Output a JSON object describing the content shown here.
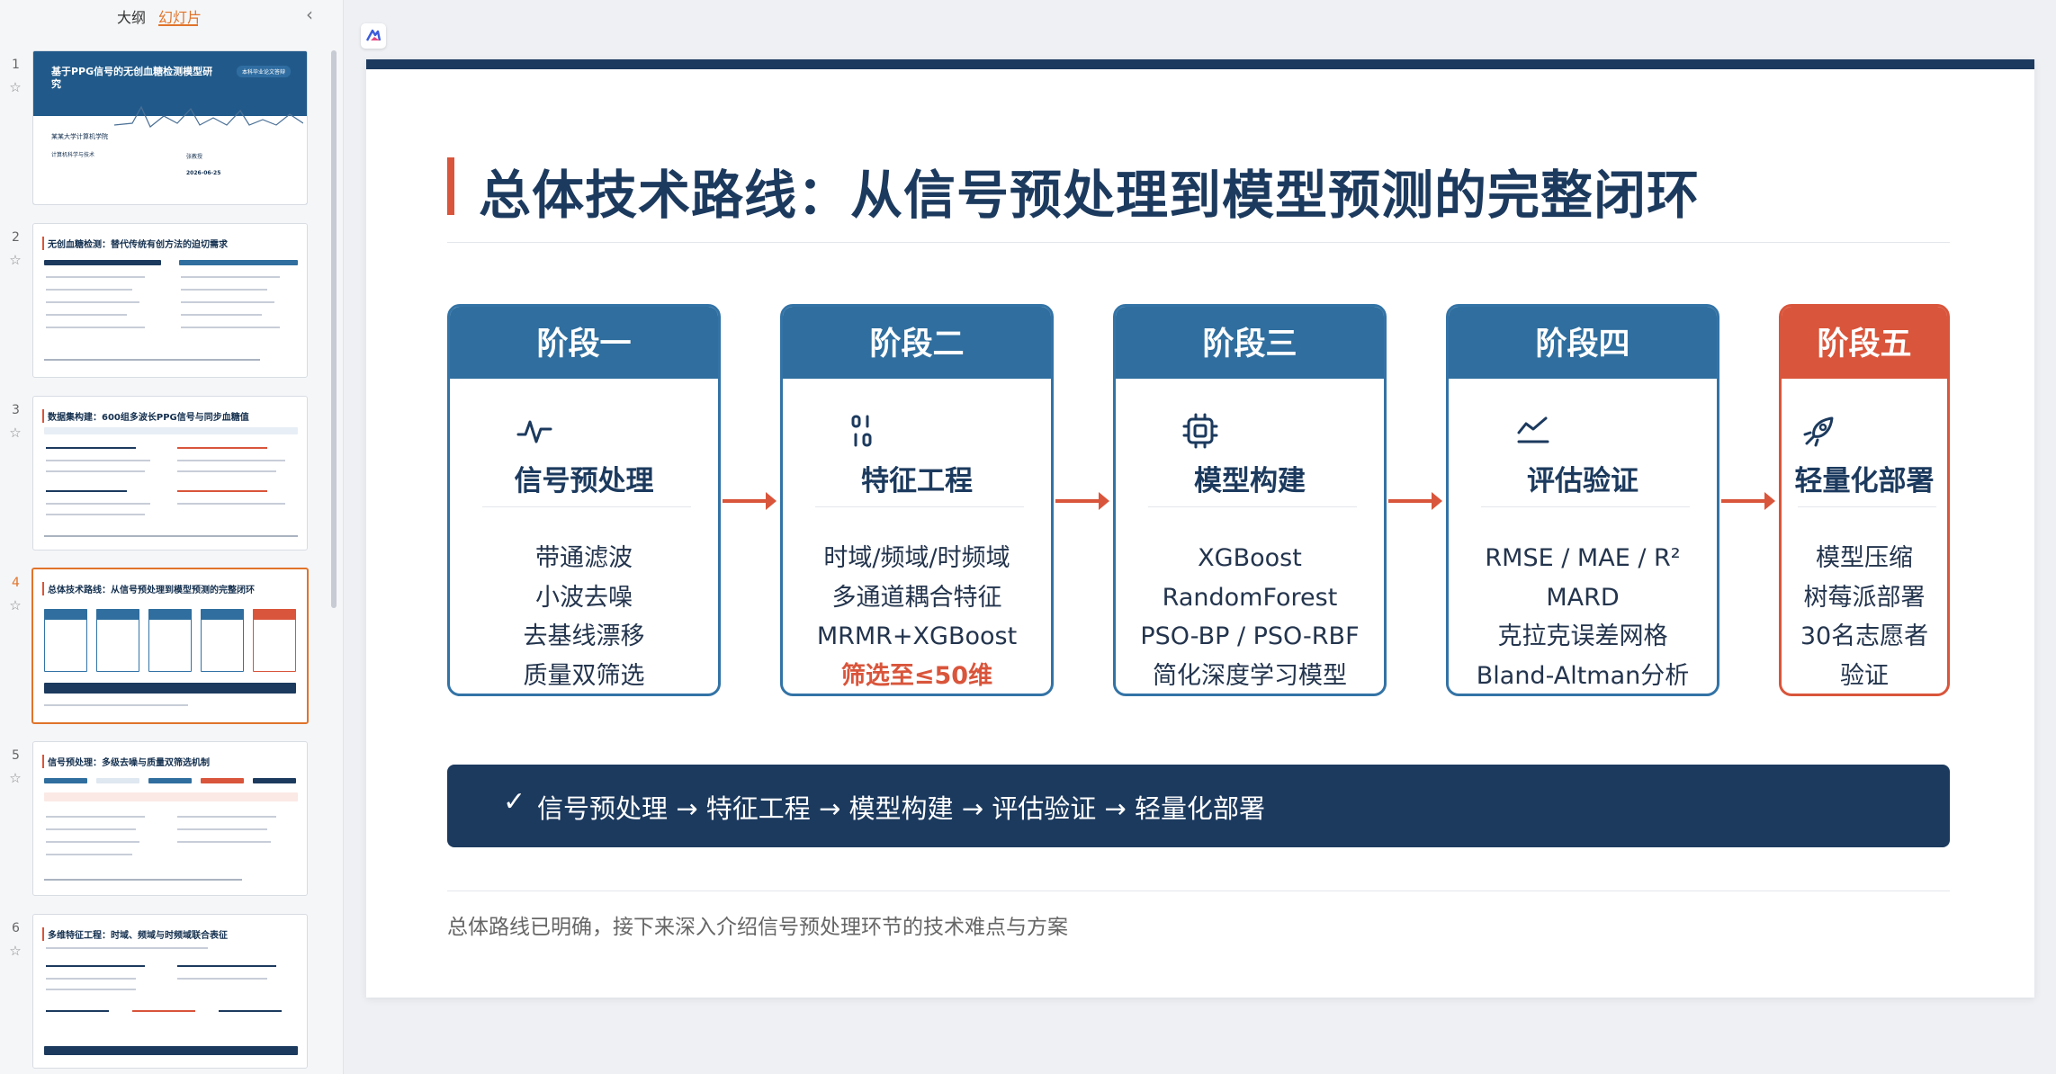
{
  "panel": {
    "tabs": [
      {
        "label": "大纲"
      },
      {
        "label": "幻灯片"
      }
    ],
    "collapse_icon": "chevron-left-icon",
    "thumbnails": [
      {
        "number": "1",
        "title": "基于PPG信号的无创血糖检测模型研究",
        "badge": "本科毕业论文答辩",
        "school": "某某大学计算机学院",
        "major": "计算机科学与技术",
        "advisor": "张教授",
        "date": "2026-06-25"
      },
      {
        "number": "2",
        "title": "无创血糖检测：替代传统有创方法的迫切需求"
      },
      {
        "number": "3",
        "title": "数据集构建：600组多波长PPG信号与同步血糖值"
      },
      {
        "number": "4",
        "title": "总体技术路线：从信号预处理到模型预测的完整闭环"
      },
      {
        "number": "5",
        "title": "信号预处理：多级去噪与质量双筛选机制"
      },
      {
        "number": "6",
        "title": "多维特征工程：时域、频域与时频域联合表征"
      }
    ],
    "active_index": 3
  },
  "slide": {
    "title": "总体技术路线：从信号预处理到模型预测的完整闭环",
    "stages": [
      {
        "head": "阶段一",
        "icon": "activity-pulse-icon",
        "name": "信号预处理",
        "items": [
          "带通滤波",
          "小波去噪",
          "去基线漂移",
          "质量双筛选"
        ],
        "highlight": ""
      },
      {
        "head": "阶段二",
        "icon": "binary-digits-icon",
        "name": "特征工程",
        "items": [
          "时域/频域/时频域",
          "多通道耦合特征",
          "MRMR+XGBoost"
        ],
        "highlight": "筛选至≤50维"
      },
      {
        "head": "阶段三",
        "icon": "cpu-chip-icon",
        "name": "模型构建",
        "items": [
          "XGBoost",
          "RandomForest",
          "PSO-BP / PSO-RBF",
          "简化深度学习模型"
        ],
        "highlight": ""
      },
      {
        "head": "阶段四",
        "icon": "line-chart-icon",
        "name": "评估验证",
        "items": [
          "RMSE / MAE / R²",
          "MARD",
          "克拉克误差网格",
          "Bland-Altman分析"
        ],
        "highlight": ""
      },
      {
        "head": "阶段五",
        "icon": "rocket-icon",
        "name": "轻量化部署",
        "items": [
          "模型压缩",
          "树莓派部署",
          "30名志愿者",
          "验证"
        ],
        "highlight": ""
      }
    ],
    "flow_check": "✓",
    "flow": "信号预处理 → 特征工程 → 模型构建 → 评估验证 → 轻量化部署",
    "footer_note": "总体路线已明确，接下来深入介绍信号预处理环节的技术难点与方案",
    "colors": {
      "navy": "#1c3a5e",
      "stage_blue": "#2f6e9e",
      "accent": "#d9553b"
    }
  }
}
